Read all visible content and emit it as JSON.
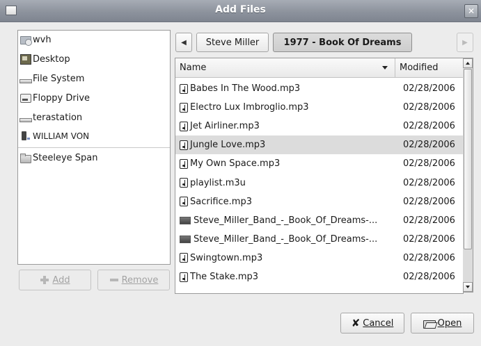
{
  "window": {
    "title": "Add Files"
  },
  "places": {
    "items": [
      {
        "label": "wvh",
        "icon": "home-folder-icon"
      },
      {
        "label": "Desktop",
        "icon": "desktop-icon"
      },
      {
        "label": "File System",
        "icon": "drive-icon"
      },
      {
        "label": "Floppy Drive",
        "icon": "floppy-icon"
      },
      {
        "label": "terastation",
        "icon": "drive-icon"
      },
      {
        "label": "WILLIAM VON",
        "icon": "media-player-icon"
      }
    ],
    "bookmarks": [
      {
        "label": "Steeleye Span",
        "icon": "folder-icon"
      }
    ],
    "add_label": "Add",
    "remove_label": "Remove"
  },
  "pathbar": {
    "crumbs": [
      "Steve Miller",
      "1977 - Book Of Dreams"
    ],
    "active_index": 1
  },
  "filelist": {
    "columns": {
      "name": "Name",
      "modified": "Modified"
    },
    "selected_index": 3,
    "rows": [
      {
        "name": "Babes In The Wood.mp3",
        "modified": "02/28/2006",
        "type": "audio"
      },
      {
        "name": "Electro Lux Imbroglio.mp3",
        "modified": "02/28/2006",
        "type": "audio"
      },
      {
        "name": "Jet Airliner.mp3",
        "modified": "02/28/2006",
        "type": "audio"
      },
      {
        "name": "Jungle Love.mp3",
        "modified": "02/28/2006",
        "type": "audio"
      },
      {
        "name": "My Own Space.mp3",
        "modified": "02/28/2006",
        "type": "audio"
      },
      {
        "name": "playlist.m3u",
        "modified": "02/28/2006",
        "type": "audio"
      },
      {
        "name": "Sacrifice.mp3",
        "modified": "02/28/2006",
        "type": "audio"
      },
      {
        "name": "Steve_Miller_Band_-_Book_Of_Dreams-...",
        "modified": "02/28/2006",
        "type": "image"
      },
      {
        "name": "Steve_Miller_Band_-_Book_Of_Dreams-...",
        "modified": "02/28/2006",
        "type": "image"
      },
      {
        "name": "Swingtown.mp3",
        "modified": "02/28/2006",
        "type": "audio"
      },
      {
        "name": "The Stake.mp3",
        "modified": "02/28/2006",
        "type": "audio"
      }
    ]
  },
  "actions": {
    "cancel_label": "Cancel",
    "open_label": "Open"
  }
}
